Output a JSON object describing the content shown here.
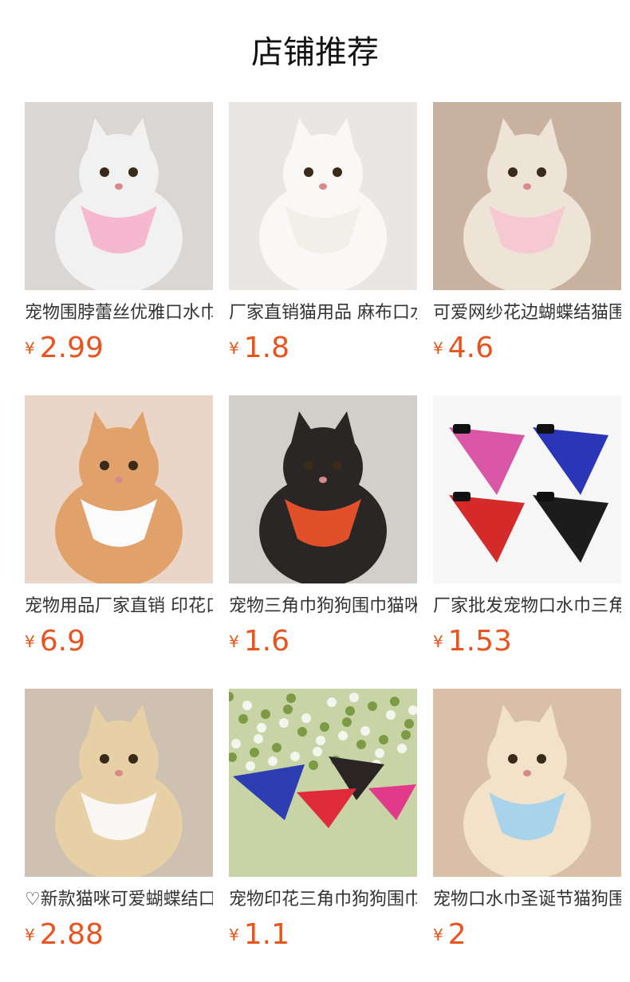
{
  "section": {
    "title": "店铺推荐"
  },
  "products": [
    {
      "name": "宠物围脖蕾丝优雅口水巾",
      "currency": "¥",
      "price": "2.99",
      "image_icon": "cat-pink-lace-bib-photo",
      "colors": {
        "bg": "#d9d6d3",
        "animal": "#f1f1f1",
        "item": "#f5b8cf"
      }
    },
    {
      "name": "厂家直销猫用品 麻布口水巾",
      "currency": "¥",
      "price": "1.8",
      "image_icon": "cat-watermelon-bandana-photo",
      "colors": {
        "bg": "#e9e6e4",
        "animal": "#faf8f6",
        "item": "#f2efe9"
      }
    },
    {
      "name": "可爱网纱花边蝴蝶结猫围脖",
      "currency": "¥",
      "price": "4.6",
      "image_icon": "cat-lace-bow-collar-photo",
      "colors": {
        "bg": "#c9b1a0",
        "animal": "#ede3d6",
        "item": "#f6c9d2"
      }
    },
    {
      "name": "宠物用品厂家直销 印花口水巾",
      "currency": "¥",
      "price": "6.9",
      "image_icon": "kitten-floral-lace-bib-photo",
      "colors": {
        "bg": "#ead6c8",
        "animal": "#e0a26a",
        "item": "#fbfbfb"
      }
    },
    {
      "name": "宠物三角巾狗狗围巾猫咪口水巾",
      "currency": "¥",
      "price": "1.6",
      "image_icon": "cat-orange-wave-bandana-photo",
      "colors": {
        "bg": "#d2cfca",
        "animal": "#2a2626",
        "item": "#e1502a"
      }
    },
    {
      "name": "厂家批发宠物口水巾三角巾",
      "currency": "¥",
      "price": "1.53",
      "image_icon": "four-paisley-bandanas-photo",
      "colors": {
        "bg": "#f6f6f6",
        "animal": "#d955a5",
        "item": "#2b35b8"
      }
    },
    {
      "name": "♡新款猫咪可爱蝴蝶结口水巾",
      "currency": "¥",
      "price": "2.88",
      "image_icon": "puppy-lace-bow-collar-photo",
      "colors": {
        "bg": "#cfc1b1",
        "animal": "#e7cfa6",
        "item": "#faf6f3"
      }
    },
    {
      "name": "宠物印花三角巾狗狗围巾",
      "currency": "¥",
      "price": "1.1",
      "image_icon": "bandanas-on-flowers-photo",
      "colors": {
        "bg": "#c8d3a6",
        "animal": "#2c3eb2",
        "item": "#e02b3b"
      }
    },
    {
      "name": "宠物口水巾圣诞节猫狗围兜",
      "currency": "¥",
      "price": "2",
      "image_icon": "puppy-mushroom-bib-photo",
      "colors": {
        "bg": "#d9bfa8",
        "animal": "#f2e2c9",
        "item": "#a9d3ea"
      }
    }
  ]
}
